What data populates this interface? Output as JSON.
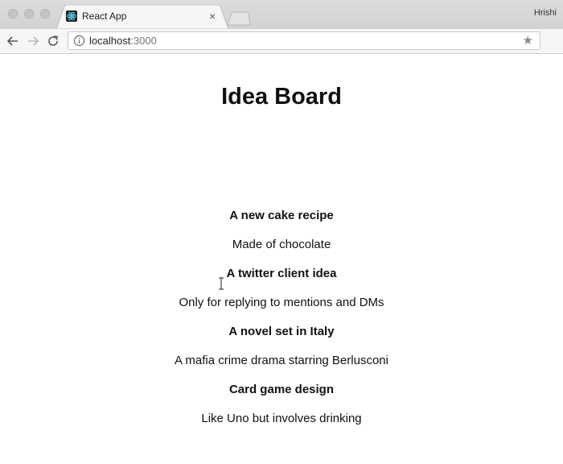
{
  "browser": {
    "tab_title": "React App",
    "tab_close": "×",
    "profile_name": "Hrishi",
    "url_host": "localhost",
    "url_port": ":3000"
  },
  "page": {
    "title": "Idea Board",
    "ideas": [
      {
        "title": "A new cake recipe",
        "body": "Made of chocolate"
      },
      {
        "title": "A twitter client idea",
        "body": "Only for replying to mentions and DMs"
      },
      {
        "title": "A novel set in Italy",
        "body": "A mafia crime drama starring Berlusconi"
      },
      {
        "title": "Card game design",
        "body": "Like Uno but involves drinking"
      }
    ]
  }
}
